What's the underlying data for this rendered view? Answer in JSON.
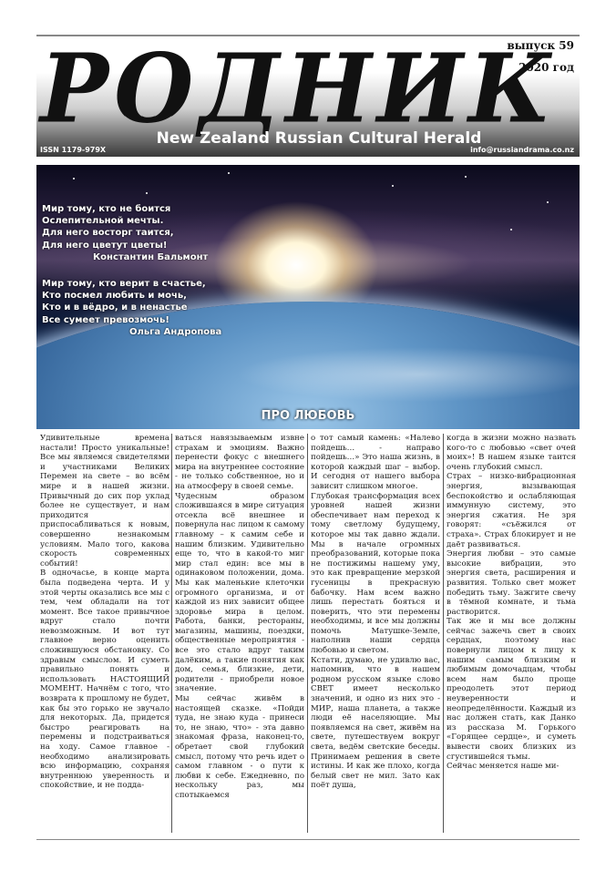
{
  "masthead": {
    "title": "РОДНИК",
    "issue": "выпуск 59",
    "year": "2020 год",
    "subtitle": "New Zealand Russian Cultural Herald",
    "issn": "ISSN 1179-979X",
    "email": "info@russiandrama.co.nz"
  },
  "hero": {
    "poem1": {
      "lines": [
        "Мир тому, кто не боится",
        "Ослепительной мечты.",
        "Для него восторг таится,",
        "Для него цветут цветы!"
      ],
      "author": "Константин Бальмонт"
    },
    "poem2": {
      "lines": [
        "Мир тому, кто верит в счастье,",
        "Кто посмел любить и мочь,",
        "Кто и в вёдро, и в ненастье",
        "Все сумеет превозмочь!"
      ],
      "author": "Ольга Андропова"
    },
    "heading": "ПРО ЛЮБОВЬ"
  },
  "article": {
    "col1": [
      "Удивительные времена настали! Просто уникальные! Все мы являемся свидетелями и участниками Великих Перемен на свете – во всём мире и в нашей жизни. Привычный до сих пор уклад более не существует, и нам приходится приспосабливаться к новым, совершенно незнакомым условиям. Мало того, какова скорость современных событий!",
      "В одночасье, в конце марта была подведена черта. И у этой черты оказались все мы с тем, чем обладали на тот момент. Все такое привычное вдруг стало почти невозможным. И вот тут главное верно оценить сложившуюся обстановку. Со здравым смыслом. И суметь правильно понять и использовать НАСТОЯЩИЙ МОМЕНТ. Начнём с того, что возврата к прошлому не будет, как бы это горько не звучало для некоторых. Да, придется быстро реагировать на перемены и подстраиваться на ходу. Самое главное - необходимо анализировать всю информацию, сохраняя внутреннюю уверенность и спокойствие, и не подда-"
    ],
    "col2": [
      "ваться навязываемым извне страхам и эмоциям. Важно перенести фокус с внешнего мира на внутреннее состояние - не только собственное, но и на атмосферу в своей семье.",
      "Чудесным образом сложившаяся в мире ситуация отсекла всё внешнее и повернула нас лицом к самому главному – к самим себе и нашим близким. Удивительно еще то, что в какой-то миг мир стал един: все мы в одинаковом положении, дома. Мы как маленькие клеточки огромного организма, и от каждой из них зависит общее здоровье мира в целом. Работа, банки, рестораны, магазины, машины, поездки, общественные мероприятия - все это стало вдруг таким далёким, а такие понятия как дом, семья, близкие, дети, родители - приобрели новое значение.",
      "Мы сейчас живём в настоящей сказке. «Пойди туда, не знаю куда - принеси то, не знаю, что» - эта давно знакомая фраза, наконец-то, обретает свой глубокий смысл, потому что речь идет о самом главном - о пути к любви к себе. Ежедневно, по нескольку раз, мы спотыкаемся"
    ],
    "col3": [
      "о тот самый камень: «Налево пойдешь… - направо пойдешь…» Это наша жизнь, в которой каждый шаг – выбор. И сегодня от нашего выбора зависит слишком многое.",
      "Глубокая трансформация всех уровней нашей жизни обеспечивает нам переход к тому светлому будущему, которое мы так давно ждали. Мы в начале огромных преобразований, которые пока не постижимы нашему уму, это как превращение мерзкой гусеницы в прекрасную бабочку. Нам всем важно лишь перестать бояться и поверить, что эти перемены необходимы, и все мы должны помочь Матушке-Земле, наполнив наши сердца любовью и светом.",
      "Кстати, думаю, не удивлю вас, напомнив, что в нашем родном русском языке слово СВЕТ имеет несколько значений, и одно из них это - МИР, наша планета, а также люди её населяющие. Мы появляемся на свет, живём на свете, путешествуем вокруг света, ведём светские беседы. Принимаем решения в свете истины. И как же плохо, когда белый свет не мил. Зато как поёт душа,"
    ],
    "col4": [
      "когда в жизни можно назвать кого-то с любовью «свет очей моих»! В нашем языке таится очень глубокий смысл.",
      "Страх – низко-вибрационная энергия, вызывающая беспокойство и ослабляющая иммунную систему, это энергия сжатия. Не зря говорят: «съёжился от страха». Страх блокирует и не даёт развиваться.",
      "Энергия любви – это самые высокие вибрации, это энергия света, расширения и развития. Только свет может победить тьму. Зажгите свечу в тёмной комнате, и тьма растворится.",
      "Так же и мы все должны сейчас зажечь свет в своих сердцах, поэтому нас повернули лицом к лицу к нашим самым близким и любимым домочадцам, чтобы всем нам было проще преодолеть этот период неуверенности и неопределённости. Каждый из нас должен стать, как Данко из рассказа М. Горького «Горящее сердце», и суметь вывести своих близких из сгустившейся тьмы.",
      "Сейчас меняется наше ми-"
    ]
  },
  "colors": {
    "text": "#1a1a1a",
    "masthead_dark": "#3a3a3a",
    "white": "#ffffff"
  }
}
